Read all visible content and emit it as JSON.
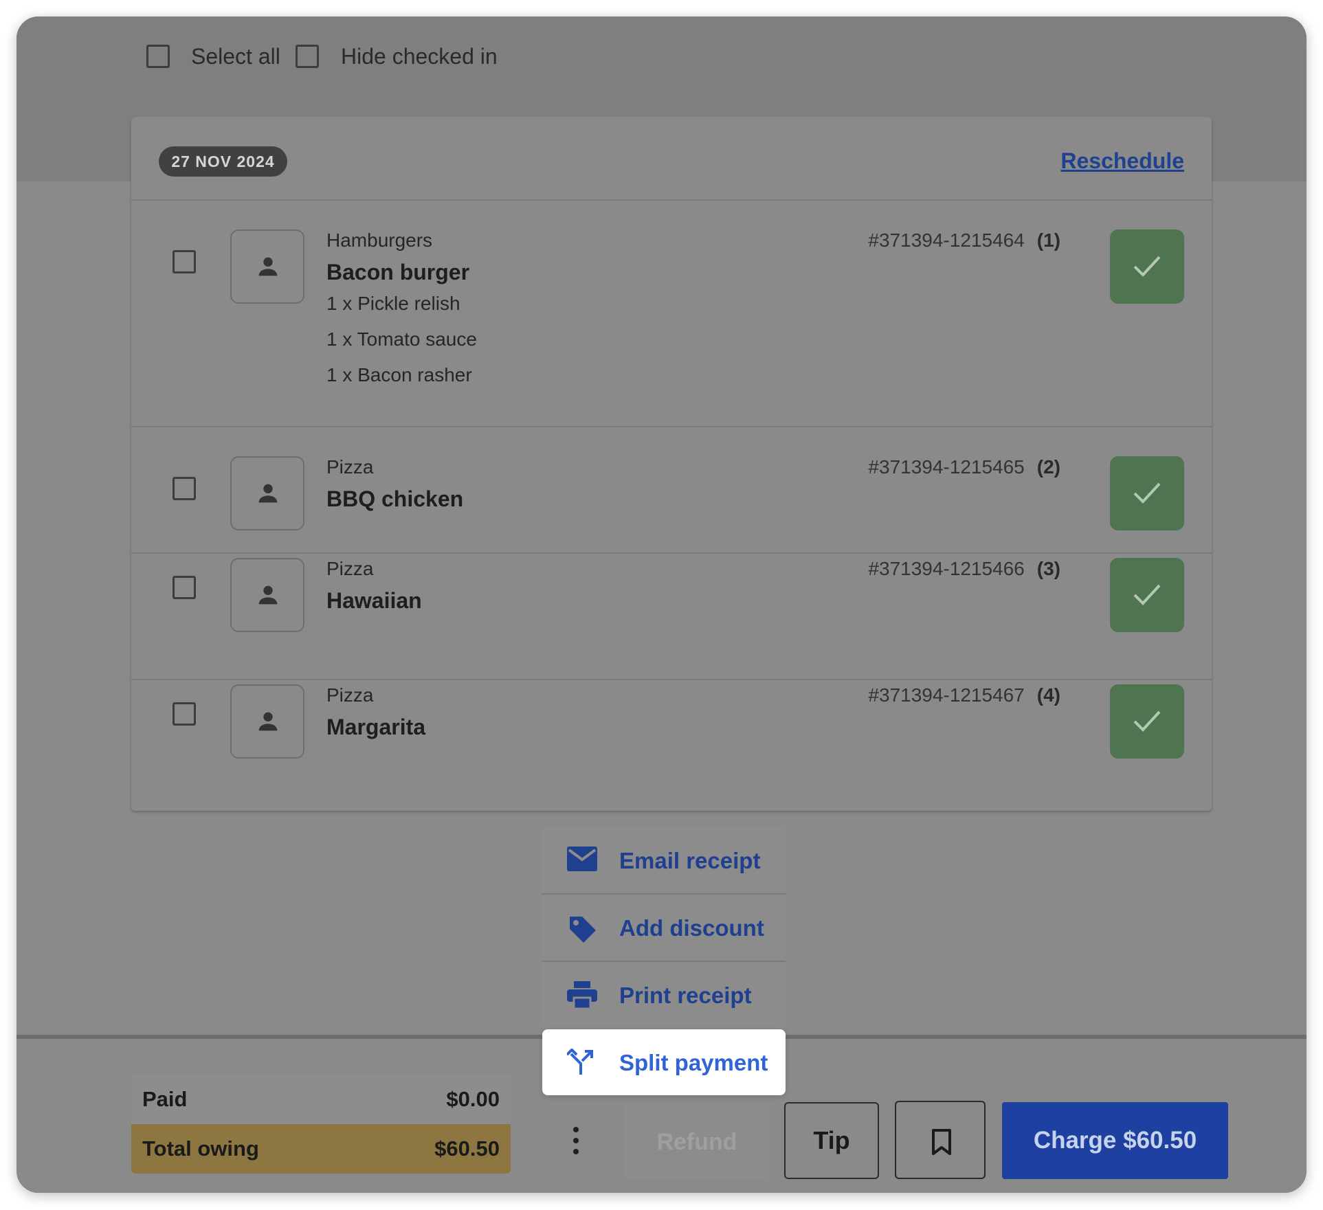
{
  "toolbar": {
    "select_all_label": "Select all",
    "hide_checked_in_label": "Hide checked in"
  },
  "booking": {
    "date": "27 NOV 2024",
    "reschedule_label": "Reschedule",
    "items": [
      {
        "category": "Hamburgers",
        "name": "Bacon burger",
        "modifiers": [
          "1 x Pickle relish",
          "1 x Tomato sauce",
          "1 x Bacon rasher"
        ],
        "order_number": "#371394-1215464",
        "index": "(1)"
      },
      {
        "category": "Pizza",
        "name": "BBQ chicken",
        "modifiers": [],
        "order_number": "#371394-1215465",
        "index": "(2)"
      },
      {
        "category": "Pizza",
        "name": "Hawaiian",
        "modifiers": [],
        "order_number": "#371394-1215466",
        "index": "(3)"
      },
      {
        "category": "Pizza",
        "name": "Margarita",
        "modifiers": [],
        "order_number": "#371394-1215467",
        "index": "(4)"
      }
    ]
  },
  "menu": {
    "items": [
      {
        "label": "Email receipt",
        "icon": "mail-icon"
      },
      {
        "label": "Add discount",
        "icon": "tag-icon"
      },
      {
        "label": "Print receipt",
        "icon": "printer-icon"
      },
      {
        "label": "Split payment",
        "icon": "split-icon"
      }
    ]
  },
  "summary": {
    "paid_label": "Paid",
    "paid_value": "$0.00",
    "owing_label": "Total owing",
    "owing_value": "$60.50"
  },
  "actions": {
    "refund_label": "Refund",
    "tip_label": "Tip",
    "charge_label": "Charge $60.50"
  },
  "colors": {
    "primary": "#1e40a0",
    "checked_in": "#4e7450",
    "owing": "#8e7640",
    "link": "#2f63d6"
  }
}
